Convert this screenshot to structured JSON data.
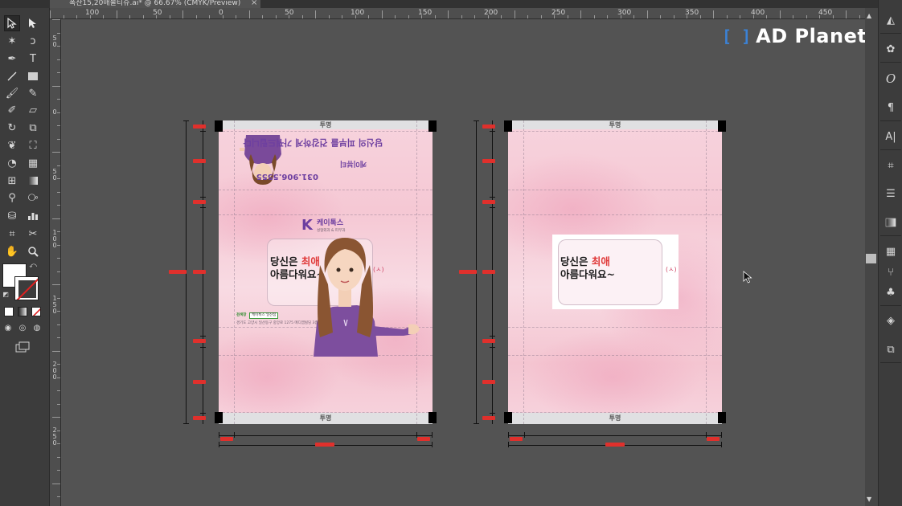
{
  "document_tab": {
    "title": "폭찬15,20매물티슈.ai* @ 66.67% (CMYK/Preview)",
    "close_glyph": "×"
  },
  "ruler_top": {
    "labels": [
      "100",
      "50",
      "0",
      "50",
      "100",
      "150",
      "200",
      "250",
      "300",
      "350",
      "400",
      "450"
    ]
  },
  "ruler_left": {
    "labels": [
      "5\n0",
      "0",
      "5\n0",
      "1\n0\n0",
      "1\n5\n0",
      "2\n0\n0",
      "2\n5\n0"
    ]
  },
  "logo": {
    "bracket": "[ ]",
    "text": "AD Planet"
  },
  "artboard_left": {
    "top_band": "투명",
    "bottom_band": "투명",
    "phone": "031.906.5555",
    "flipped_headline": "당신의 피부를 건강하게 가꿔드립니다",
    "brand_flipped": "케이뷰티",
    "k_logo": "K",
    "brand_name": "케이톡스",
    "brand_sub": "성형외과 & 피부과",
    "slogan_line1_a": "당신은 ",
    "slogan_line1_hl": "최애",
    "slogan_line2": "아름다워요~",
    "search_label": "검색창",
    "search_value": "케이톡스 일산점",
    "address": "경기도 고양시 일산동구 중앙로 1275 메디엠빌딩 3층"
  },
  "artboard_right": {
    "top_band": "투명",
    "bottom_band": "투명",
    "slogan_line1_a": "당신은 ",
    "slogan_line1_hl": "최애",
    "slogan_line2": "아름다워요~"
  },
  "colors": {
    "workspace": "#535353",
    "panel": "#3c3c3c",
    "dimension_marker": "#e0302c",
    "artboard_pink": "#f5c8d4",
    "brand_purple": "#6d3fa0",
    "logo_blue": "#3b82d6"
  },
  "tools_left": [
    "selection-tool",
    "direct-selection-tool",
    "magic-wand-tool",
    "lasso-tool",
    "pen-tool",
    "type-tool",
    "line-tool",
    "rectangle-tool",
    "paintbrush-tool",
    "pencil-tool",
    "blob-brush-tool",
    "eraser-tool",
    "rotate-tool",
    "scale-tool",
    "warp-tool",
    "free-transform-tool",
    "shape-builder-tool",
    "perspective-grid-tool",
    "mesh-tool",
    "gradient-tool",
    "eyedropper-tool",
    "blend-tool",
    "symbol-sprayer-tool",
    "column-graph-tool",
    "artboard-tool",
    "slice-tool",
    "hand-tool",
    "zoom-tool"
  ],
  "panels_right": [
    "color-guide-icon",
    "color-palette-icon",
    "opentype-icon",
    "paragraph-icon",
    "character-icon",
    "transform-icon",
    "align-icon",
    "gradient-icon",
    "swatches-icon",
    "brushes-icon",
    "symbols-icon",
    "layers-icon",
    "artboards-icon"
  ]
}
